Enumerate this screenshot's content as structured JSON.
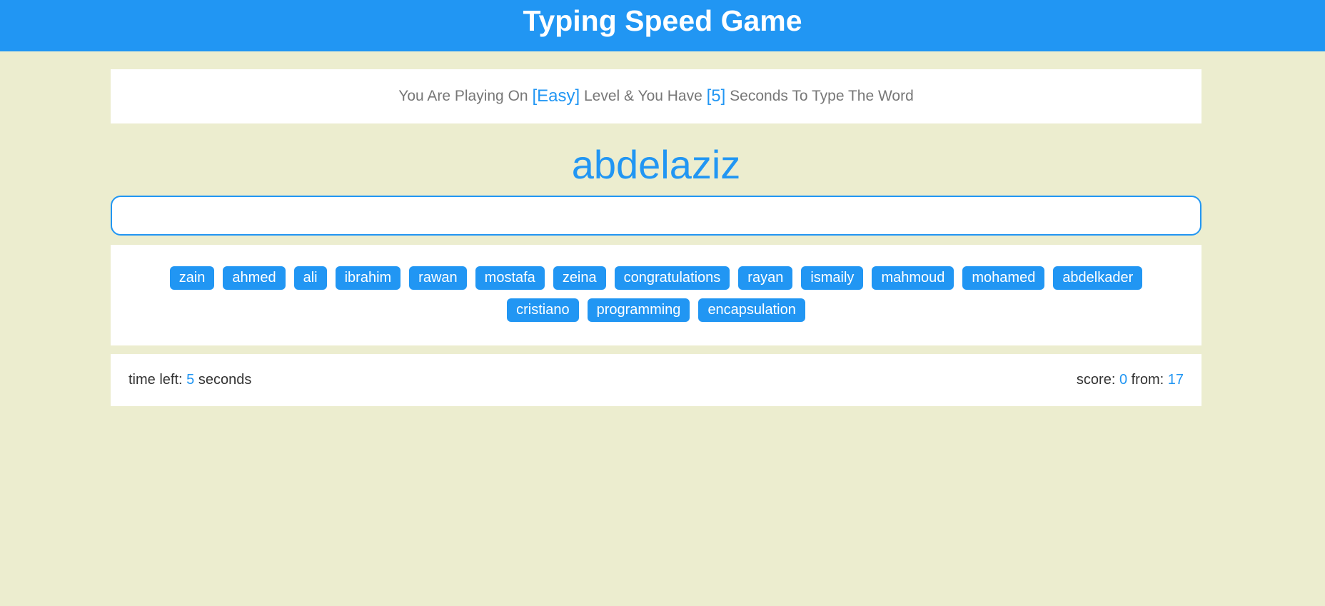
{
  "header": {
    "title": "Typing Speed Game"
  },
  "message": {
    "prefix": "You Are Playing On",
    "level": "[Easy]",
    "middle": "Level & You Have",
    "seconds": "[5]",
    "suffix": "Seconds To Type The Word"
  },
  "current_word": "abdelaziz",
  "input": {
    "value": "",
    "placeholder": ""
  },
  "words": [
    "zain",
    "ahmed",
    "ali",
    "ibrahim",
    "rawan",
    "mostafa",
    "zeina",
    "congratulations",
    "rayan",
    "ismaily",
    "mahmoud",
    "mohamed",
    "abdelkader",
    "cristiano",
    "programming",
    "encapsulation"
  ],
  "control": {
    "time_label": "time left:",
    "time_value": "5",
    "time_unit": "seconds",
    "score_label": "score:",
    "score_value": "0",
    "total_label": "from:",
    "total_value": "17"
  },
  "colors": {
    "accent": "#2196f3",
    "background": "#ecedcf",
    "panel": "#ffffff"
  }
}
